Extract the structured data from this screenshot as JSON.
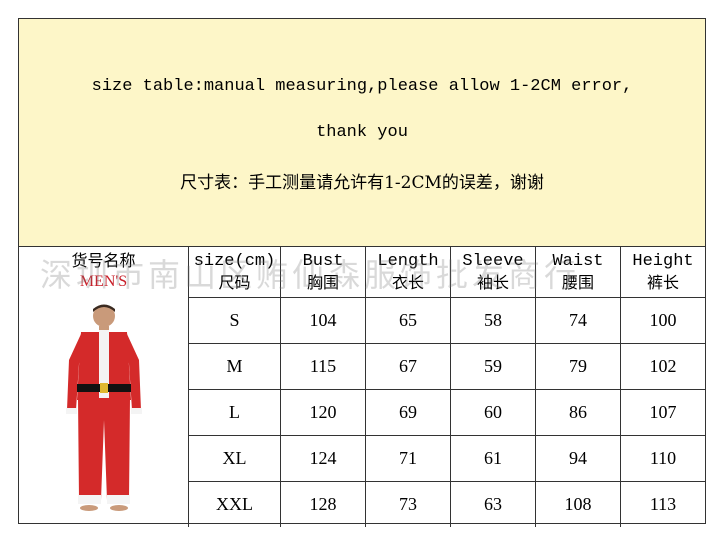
{
  "note": {
    "line1": "size table:manual measuring,please allow 1-2CM error,",
    "line2": "thank you",
    "line3": "尺寸表：手工测量请允许有1-2CM的误差，谢谢"
  },
  "product": {
    "label_cn": "货号名称",
    "label_en": "MEN'S",
    "image": "man-in-red-santa-pajamas"
  },
  "table": {
    "headers": [
      {
        "en": "size(cm)",
        "cn": "尺码"
      },
      {
        "en": "Bust",
        "cn": "胸围"
      },
      {
        "en": "Length",
        "cn": "衣长"
      },
      {
        "en": "Sleeve",
        "cn": "袖长"
      },
      {
        "en": "Waist",
        "cn": "腰围"
      },
      {
        "en": "Height",
        "cn": "裤长"
      }
    ],
    "rows": [
      [
        "S",
        "104",
        "65",
        "58",
        "74",
        "100"
      ],
      [
        "M",
        "115",
        "67",
        "59",
        "79",
        "102"
      ],
      [
        "L",
        "120",
        "69",
        "60",
        "86",
        "107"
      ],
      [
        "XL",
        "124",
        "71",
        "61",
        "94",
        "110"
      ],
      [
        "XXL",
        "128",
        "73",
        "63",
        "108",
        "113"
      ]
    ]
  },
  "watermark": "深圳市南山区贿仙森服饰批发商行",
  "colors": {
    "note_bg": "#fdf6c8",
    "mens_text": "#c8202a",
    "suit_red": "#d42a2a"
  }
}
